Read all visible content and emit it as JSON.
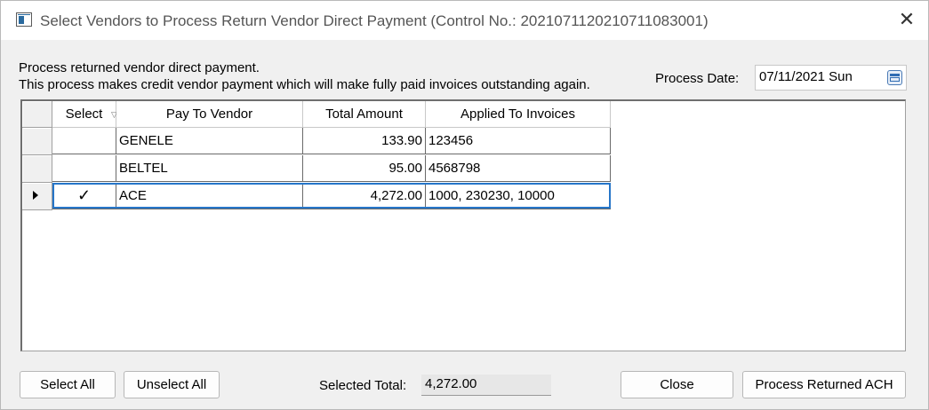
{
  "window": {
    "title": "Select Vendors to Process Return Vendor Direct Payment (Control No.: 20210711202107110830​01)",
    "close_glyph": "✕"
  },
  "description": {
    "line1": "Process returned vendor direct payment.",
    "line2": "This process makes credit vendor payment which will make fully paid invoices outstanding again."
  },
  "process_date": {
    "label": "Process Date:",
    "value": "07/11/2021 Sun",
    "icon": "calendar-icon"
  },
  "grid": {
    "columns": [
      "Select",
      "Pay To Vendor",
      "Total Amount",
      "Applied To Invoices"
    ],
    "rows": [
      {
        "select": "",
        "vendor": "GENELE",
        "amount": "133.90",
        "invoices": "123456"
      },
      {
        "select": "",
        "vendor": "BELTEL",
        "amount": "95.00",
        "invoices": "4568798"
      },
      {
        "select": "✓",
        "vendor": "ACE",
        "amount": "4,272.00",
        "invoices": "1000, 230230, 10000"
      }
    ],
    "current_row_marker": "▶"
  },
  "footer": {
    "select_all": "Select All",
    "unselect_all": "Unselect All",
    "selected_total_label": "Selected Total:",
    "selected_total_value": "4,272.00",
    "close": "Close",
    "process": "Process Returned ACH"
  },
  "colors": {
    "selection_border": "#2676c9",
    "window_bg": "#f0f0f0"
  }
}
